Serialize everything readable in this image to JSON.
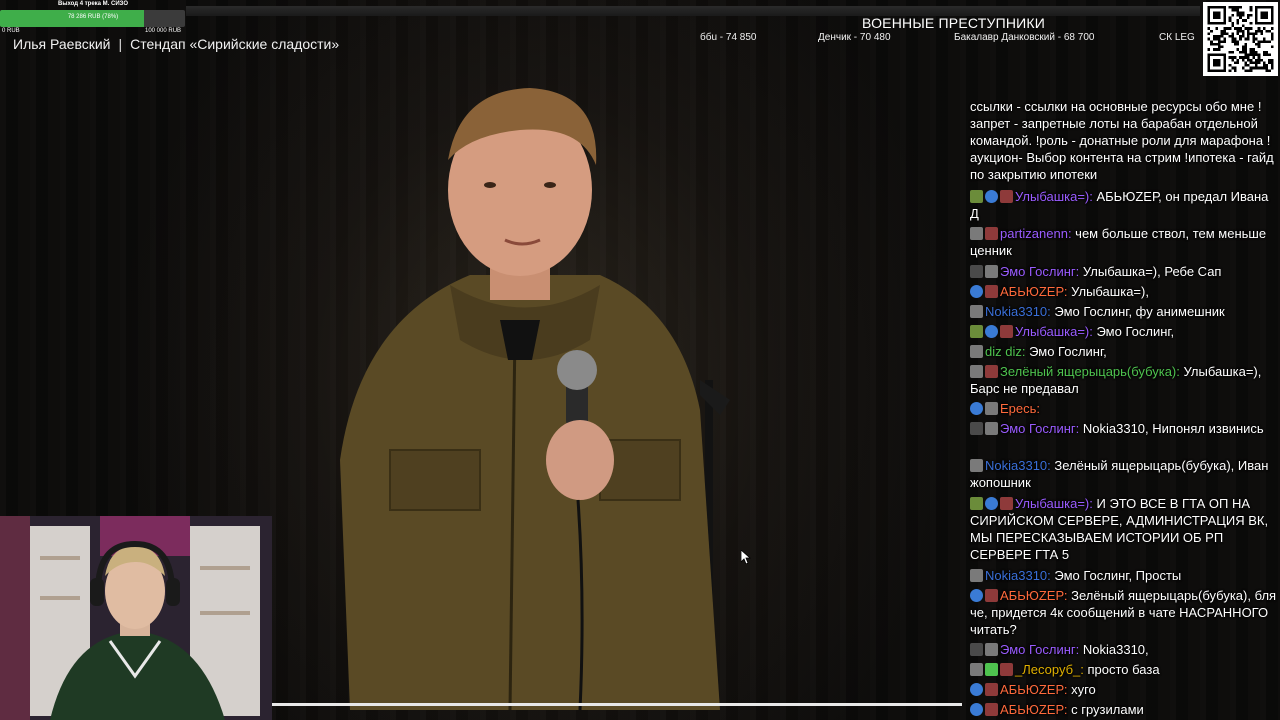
{
  "goal": {
    "title": "Выход 4 трека М. СИЗО",
    "value_text": "78 286 RUB (78%)",
    "progress": 0.78,
    "min_label": "0 RUB",
    "max_label": "100 000 RUB"
  },
  "stream": {
    "streamer": "Илья Раевский",
    "separator": "|",
    "title": "Стендап «Сирийские сладости»"
  },
  "board": {
    "title": "ВОЕННЫЕ ПРЕСТУПНИКИ",
    "entries": [
      "ббu - 74 850",
      "Денчик - 70 480",
      "Бакалавр Данковский - 68 700",
      "СК LEG"
    ]
  },
  "chat": {
    "messages": [
      {
        "nick": "",
        "nick_color": "#ffffff",
        "badges": [],
        "text": "ссылки - ссылки на основные ресурсы обо мне ! запрет - запретные лоты на барабан отдельной командой. !роль - донатные роли для марафона !аукцион- Выбор контента на стрим !ипотека - гайд по закрытию ипотеки"
      },
      {
        "nick": "Улыбашка=):",
        "nick_color": "#9a5cff",
        "badges": [
          "green",
          "blue",
          "red"
        ],
        "text": "АБЬЮZЕР, он предал Ивана Д"
      },
      {
        "nick": "partizanenn:",
        "nick_color": "#9a5cff",
        "badges": [
          "gray",
          "red"
        ],
        "text": "чем больше ствол, тем меньше ценник"
      },
      {
        "nick": "Эмо Гослинг:",
        "nick_color": "#9a5cff",
        "badges": [
          "dark",
          "gray"
        ],
        "text": "Улыбашка=), Ребе Сап"
      },
      {
        "nick": "АБЬЮZЕР:",
        "nick_color": "#ff6a3c",
        "badges": [
          "blue",
          "red"
        ],
        "text": "Улыбашка=),"
      },
      {
        "nick": "Nokia3310:",
        "nick_color": "#3a6fd8",
        "badges": [
          "gray"
        ],
        "text": "Эмо Гослинг, фу анимешник"
      },
      {
        "nick": "Улыбашка=):",
        "nick_color": "#9a5cff",
        "badges": [
          "green",
          "blue",
          "red"
        ],
        "text": "Эмо Гослинг,"
      },
      {
        "nick": "diz diz:",
        "nick_color": "#4fc34f",
        "badges": [
          "gray"
        ],
        "text": "Эмо Гослинг,"
      },
      {
        "nick": "Зелёный ящерыцарь(бубука):",
        "nick_color": "#4fc34f",
        "badges": [
          "gray",
          "red"
        ],
        "text": "Улыбашка=), Барс не предавал"
      },
      {
        "nick": "Ересь:",
        "nick_color": "#ff6a3c",
        "badges": [
          "blue",
          "gray"
        ],
        "text": ""
      },
      {
        "nick": "Эмо Гослинг:",
        "nick_color": "#9a5cff",
        "badges": [
          "dark",
          "gray"
        ],
        "text": "Nokia3310, Нипонял извинись"
      },
      {
        "nick": "Nokia3310:",
        "nick_color": "#3a6fd8",
        "badges": [
          "gray"
        ],
        "text": "Зелёный ящерыцарь(бубука), Иван жопошник"
      },
      {
        "nick": "Улыбашка=):",
        "nick_color": "#9a5cff",
        "badges": [
          "green",
          "blue",
          "red"
        ],
        "text": "И ЭТО ВСЕ В ГТА ОП НА СИРИЙСКОМ СЕРВЕРЕ, АДМИНИСТРАЦИЯ ВК, МЫ ПЕРЕСКАЗЫВАЕМ ИСТОРИИ ОБ РП СЕРВЕРЕ ГТА 5"
      },
      {
        "nick": "Nokia3310:",
        "nick_color": "#3a6fd8",
        "badges": [
          "gray"
        ],
        "text": "Эмо Гослинг, Просты"
      },
      {
        "nick": "АБЬЮZЕР:",
        "nick_color": "#ff6a3c",
        "badges": [
          "blue",
          "red"
        ],
        "text": "Зелёный ящерыцарь(бубука), бля че, придется 4к сообщений в чате НАСРАННОГО читать?"
      },
      {
        "nick": "Эмо Гослинг:",
        "nick_color": "#9a5cff",
        "badges": [
          "dark",
          "gray"
        ],
        "text": "Nokia3310,"
      },
      {
        "nick": "_Лесоруб_:",
        "nick_color": "#e0b000",
        "badges": [
          "gray",
          "lime",
          "red"
        ],
        "text": "просто база"
      },
      {
        "nick": "АБЬЮZЕР:",
        "nick_color": "#ff6a3c",
        "badges": [
          "blue",
          "red"
        ],
        "text": "хуго"
      },
      {
        "nick": "АБЬЮZЕР:",
        "nick_color": "#ff6a3c",
        "badges": [
          "blue",
          "red"
        ],
        "text": "с грузилами"
      }
    ]
  }
}
